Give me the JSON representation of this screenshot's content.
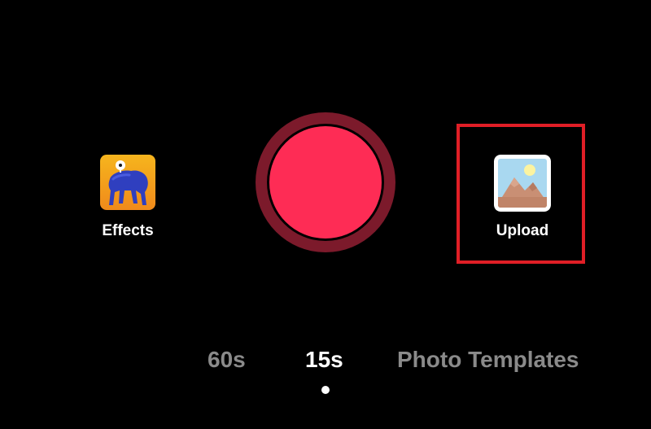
{
  "controls": {
    "effects": {
      "label": "Effects",
      "icon": "effects-character-icon"
    },
    "record": {
      "icon": "record-button",
      "ring_color": "#7c1a2b",
      "core_color": "#fe2c55"
    },
    "upload": {
      "label": "Upload",
      "icon": "image-gallery-icon",
      "highlight_color": "#e01e26"
    }
  },
  "modes": {
    "items": [
      {
        "label": "60s",
        "selected": false
      },
      {
        "label": "15s",
        "selected": true
      },
      {
        "label": "Photo Templates",
        "selected": false
      }
    ],
    "selected_color": "#ffffff",
    "unselected_color": "#8a8a8a"
  }
}
